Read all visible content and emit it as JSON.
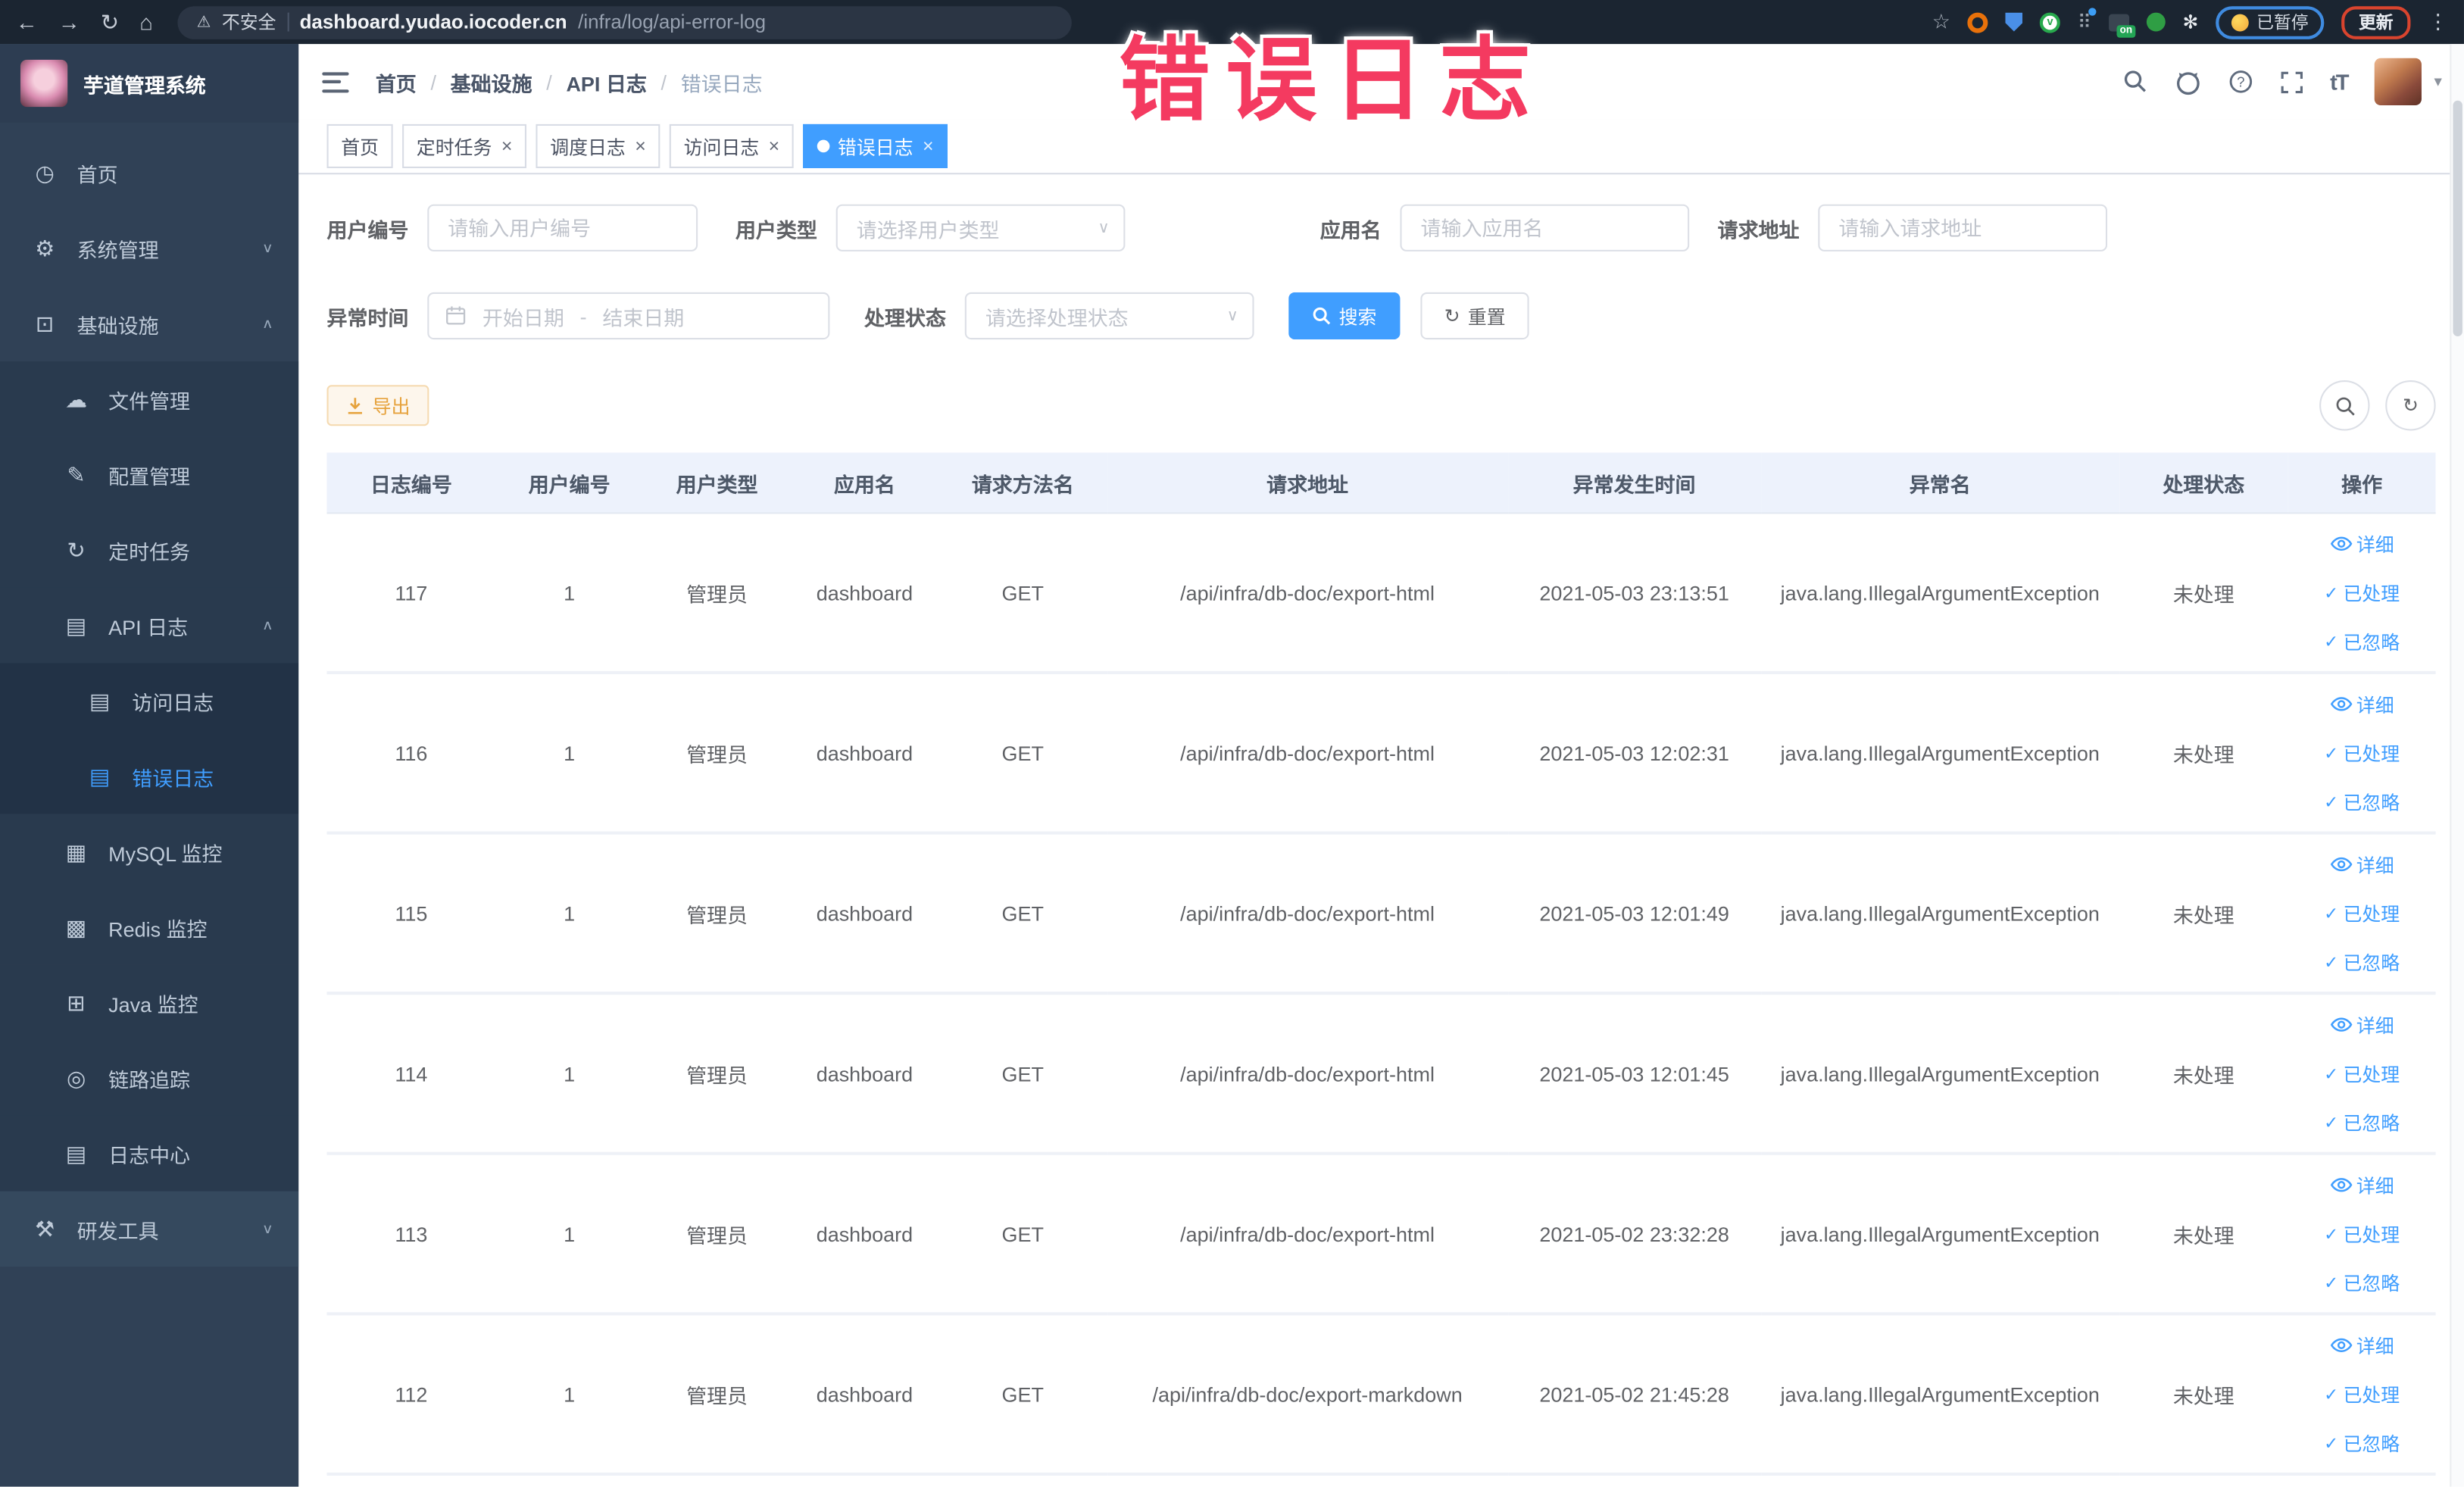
{
  "annotation": {
    "text": "错误日志",
    "color": "#f43a60"
  },
  "colors": {
    "accent": "#409eff",
    "sidebar_bg": "#304156",
    "warning_btn": "#e6a23c",
    "header_row_bg": "#edf2fc"
  },
  "icons": {
    "back": "←",
    "forward": "→",
    "reload": "↻",
    "home": "⌂",
    "warning": "⚠",
    "star": "☆",
    "grid": "⠿",
    "paw": "✻",
    "kebab": "⋮",
    "caret_down": "▾",
    "select_arrow": "∨",
    "chevron_up": "∧",
    "chevron_down": "∨",
    "check": "✓",
    "refresh": "↻",
    "close": "×",
    "font_size": "tT",
    "green_v": "v",
    "on_badge": "on"
  },
  "browser": {
    "insecure_label": "不安全",
    "host": "dashboard.yudao.iocoder.cn",
    "path": "/infra/log/api-error-log",
    "paused_label": "已暂停",
    "update_label": "更新"
  },
  "sidebar": {
    "title": "芋道管理系统",
    "items": [
      {
        "key": "home",
        "label": "首页",
        "icon": "dashboard-icon",
        "glyph": "◷",
        "level": 1
      },
      {
        "key": "system",
        "label": "系统管理",
        "icon": "gear-icon",
        "glyph": "⚙",
        "level": 1,
        "chevron": "down"
      },
      {
        "key": "infra",
        "label": "基础设施",
        "icon": "infrastructure-icon",
        "glyph": "⊡",
        "level": 1,
        "chevron": "up"
      },
      {
        "key": "file",
        "label": "文件管理",
        "icon": "cloud-icon",
        "glyph": "☁",
        "level": 2
      },
      {
        "key": "config",
        "label": "配置管理",
        "icon": "edit-icon",
        "glyph": "✎",
        "level": 2
      },
      {
        "key": "job",
        "label": "定时任务",
        "icon": "timer-icon",
        "glyph": "↻",
        "level": 2
      },
      {
        "key": "api-log",
        "label": "API 日志",
        "icon": "log-icon",
        "glyph": "▤",
        "level": 2,
        "chevron": "up"
      },
      {
        "key": "access-log",
        "label": "访问日志",
        "icon": "access-log-icon",
        "glyph": "▤",
        "level": 3
      },
      {
        "key": "error-log",
        "label": "错误日志",
        "icon": "error-log-icon",
        "glyph": "▤",
        "level": 3,
        "active": true
      },
      {
        "key": "mysql",
        "label": "MySQL 监控",
        "icon": "mysql-monitor-icon",
        "glyph": "▦",
        "level": 2
      },
      {
        "key": "redis",
        "label": "Redis 监控",
        "icon": "redis-monitor-icon",
        "glyph": "▩",
        "level": 2
      },
      {
        "key": "java",
        "label": "Java 监控",
        "icon": "java-monitor-icon",
        "glyph": "⊞",
        "level": 2
      },
      {
        "key": "trace",
        "label": "链路追踪",
        "icon": "trace-icon",
        "glyph": "◎",
        "level": 2
      },
      {
        "key": "log-center",
        "label": "日志中心",
        "icon": "log-center-icon",
        "glyph": "▤",
        "level": 2
      },
      {
        "key": "dev-tools",
        "label": "研发工具",
        "icon": "tools-icon",
        "glyph": "⚒",
        "level": 1,
        "chevron": "down"
      }
    ]
  },
  "header": {
    "breadcrumb": [
      "首页",
      "基础设施",
      "API 日志",
      "错误日志"
    ],
    "breadcrumb_sep": "/"
  },
  "tabs": [
    {
      "key": "home",
      "label": "首页",
      "closable": false,
      "active": false
    },
    {
      "key": "job",
      "label": "定时任务",
      "closable": true,
      "active": false
    },
    {
      "key": "job-log",
      "label": "调度日志",
      "closable": true,
      "active": false
    },
    {
      "key": "access-log",
      "label": "访问日志",
      "closable": true,
      "active": false
    },
    {
      "key": "error-log",
      "label": "错误日志",
      "closable": true,
      "active": true
    }
  ],
  "filters": {
    "user_id": {
      "label": "用户编号",
      "placeholder": "请输入用户编号"
    },
    "user_type": {
      "label": "用户类型",
      "placeholder": "请选择用户类型"
    },
    "app_name": {
      "label": "应用名",
      "placeholder": "请输入应用名"
    },
    "request_url": {
      "label": "请求地址",
      "placeholder": "请输入请求地址"
    },
    "exception_time": {
      "label": "异常时间",
      "start_placeholder": "开始日期",
      "separator": "-",
      "end_placeholder": "结束日期"
    },
    "process_status": {
      "label": "处理状态",
      "placeholder": "请选择处理状态"
    },
    "search_label": "搜索",
    "reset_label": "重置"
  },
  "toolbar": {
    "export_label": "导出"
  },
  "table": {
    "columns": [
      "日志编号",
      "用户编号",
      "用户类型",
      "应用名",
      "请求方法名",
      "请求地址",
      "异常发生时间",
      "异常名",
      "处理状态",
      "操作"
    ],
    "actions": [
      {
        "label": "详细"
      },
      {
        "label": "已处理"
      },
      {
        "label": "已忽略"
      }
    ],
    "rows": [
      {
        "id": "117",
        "user_id": "1",
        "user_type": "管理员",
        "app": "dashboard",
        "method": "GET",
        "url": "/api/infra/db-doc/export-html",
        "time": "2021-05-03 23:13:51",
        "exception": "java.lang.IllegalArgumentException",
        "status": "未处理"
      },
      {
        "id": "116",
        "user_id": "1",
        "user_type": "管理员",
        "app": "dashboard",
        "method": "GET",
        "url": "/api/infra/db-doc/export-html",
        "time": "2021-05-03 12:02:31",
        "exception": "java.lang.IllegalArgumentException",
        "status": "未处理"
      },
      {
        "id": "115",
        "user_id": "1",
        "user_type": "管理员",
        "app": "dashboard",
        "method": "GET",
        "url": "/api/infra/db-doc/export-html",
        "time": "2021-05-03 12:01:49",
        "exception": "java.lang.IllegalArgumentException",
        "status": "未处理"
      },
      {
        "id": "114",
        "user_id": "1",
        "user_type": "管理员",
        "app": "dashboard",
        "method": "GET",
        "url": "/api/infra/db-doc/export-html",
        "time": "2021-05-03 12:01:45",
        "exception": "java.lang.IllegalArgumentException",
        "status": "未处理"
      },
      {
        "id": "113",
        "user_id": "1",
        "user_type": "管理员",
        "app": "dashboard",
        "method": "GET",
        "url": "/api/infra/db-doc/export-html",
        "time": "2021-05-02 23:32:28",
        "exception": "java.lang.IllegalArgumentException",
        "status": "未处理"
      },
      {
        "id": "112",
        "user_id": "1",
        "user_type": "管理员",
        "app": "dashboard",
        "method": "GET",
        "url": "/api/infra/db-doc/export-markdown",
        "time": "2021-05-02 21:45:28",
        "exception": "java.lang.IllegalArgumentException",
        "status": "未处理"
      }
    ]
  }
}
